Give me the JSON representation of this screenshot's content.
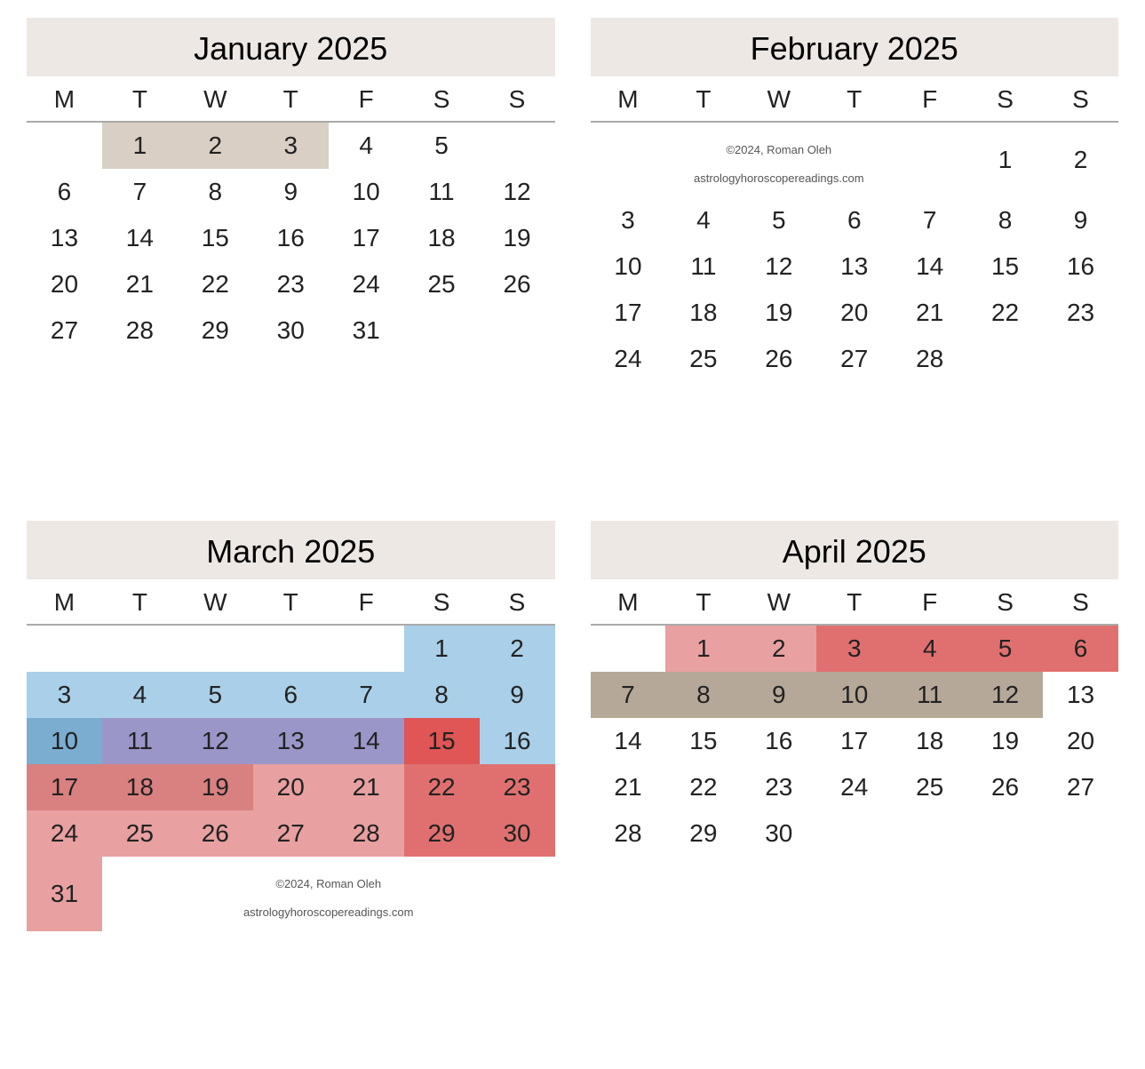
{
  "calendars": [
    {
      "id": "jan-2025",
      "title": "January 2025",
      "days_header": [
        "M",
        "T",
        "W",
        "T",
        "F",
        "S",
        "S"
      ],
      "weeks": [
        [
          {
            "day": "",
            "cls": ""
          },
          {
            "day": "1",
            "cls": "cell-beige"
          },
          {
            "day": "2",
            "cls": "cell-beige"
          },
          {
            "day": "3",
            "cls": "cell-beige"
          },
          {
            "day": "4",
            "cls": ""
          },
          {
            "day": "5",
            "cls": ""
          }
        ],
        [
          {
            "day": "6",
            "cls": ""
          },
          {
            "day": "7",
            "cls": ""
          },
          {
            "day": "8",
            "cls": ""
          },
          {
            "day": "9",
            "cls": ""
          },
          {
            "day": "10",
            "cls": ""
          },
          {
            "day": "11",
            "cls": ""
          },
          {
            "day": "12",
            "cls": ""
          }
        ],
        [
          {
            "day": "13",
            "cls": ""
          },
          {
            "day": "14",
            "cls": ""
          },
          {
            "day": "15",
            "cls": ""
          },
          {
            "day": "16",
            "cls": ""
          },
          {
            "day": "17",
            "cls": ""
          },
          {
            "day": "18",
            "cls": ""
          },
          {
            "day": "19",
            "cls": ""
          }
        ],
        [
          {
            "day": "20",
            "cls": ""
          },
          {
            "day": "21",
            "cls": ""
          },
          {
            "day": "22",
            "cls": ""
          },
          {
            "day": "23",
            "cls": ""
          },
          {
            "day": "24",
            "cls": ""
          },
          {
            "day": "25",
            "cls": ""
          },
          {
            "day": "26",
            "cls": ""
          }
        ],
        [
          {
            "day": "27",
            "cls": ""
          },
          {
            "day": "28",
            "cls": ""
          },
          {
            "day": "29",
            "cls": ""
          },
          {
            "day": "30",
            "cls": ""
          },
          {
            "day": "31",
            "cls": ""
          },
          {
            "day": "",
            "cls": ""
          },
          {
            "day": "",
            "cls": ""
          }
        ]
      ]
    },
    {
      "id": "feb-2025",
      "title": "February 2025",
      "days_header": [
        "M",
        "T",
        "W",
        "T",
        "F",
        "S",
        "S"
      ],
      "weeks": [
        [
          {
            "day": "",
            "cls": "",
            "colspan": 5,
            "copyright": true
          },
          {
            "day": "1",
            "cls": ""
          },
          {
            "day": "2",
            "cls": ""
          }
        ],
        [
          {
            "day": "3",
            "cls": ""
          },
          {
            "day": "4",
            "cls": ""
          },
          {
            "day": "5",
            "cls": ""
          },
          {
            "day": "6",
            "cls": ""
          },
          {
            "day": "7",
            "cls": ""
          },
          {
            "day": "8",
            "cls": ""
          },
          {
            "day": "9",
            "cls": ""
          }
        ],
        [
          {
            "day": "10",
            "cls": ""
          },
          {
            "day": "11",
            "cls": ""
          },
          {
            "day": "12",
            "cls": ""
          },
          {
            "day": "13",
            "cls": ""
          },
          {
            "day": "14",
            "cls": ""
          },
          {
            "day": "15",
            "cls": ""
          },
          {
            "day": "16",
            "cls": ""
          }
        ],
        [
          {
            "day": "17",
            "cls": ""
          },
          {
            "day": "18",
            "cls": ""
          },
          {
            "day": "19",
            "cls": ""
          },
          {
            "day": "20",
            "cls": ""
          },
          {
            "day": "21",
            "cls": ""
          },
          {
            "day": "22",
            "cls": ""
          },
          {
            "day": "23",
            "cls": ""
          }
        ],
        [
          {
            "day": "24",
            "cls": ""
          },
          {
            "day": "25",
            "cls": ""
          },
          {
            "day": "26",
            "cls": ""
          },
          {
            "day": "27",
            "cls": ""
          },
          {
            "day": "28",
            "cls": ""
          },
          {
            "day": "",
            "cls": ""
          },
          {
            "day": "",
            "cls": ""
          }
        ]
      ]
    },
    {
      "id": "mar-2025",
      "title": "March 2025",
      "days_header": [
        "M",
        "T",
        "W",
        "T",
        "F",
        "S",
        "S"
      ],
      "weeks": [
        [
          {
            "day": "",
            "cls": ""
          },
          {
            "day": "",
            "cls": ""
          },
          {
            "day": "",
            "cls": ""
          },
          {
            "day": "",
            "cls": ""
          },
          {
            "day": "",
            "cls": ""
          },
          {
            "day": "1",
            "cls": "cell-blue"
          },
          {
            "day": "2",
            "cls": "cell-blue"
          }
        ],
        [
          {
            "day": "3",
            "cls": "cell-blue"
          },
          {
            "day": "4",
            "cls": "cell-blue"
          },
          {
            "day": "5",
            "cls": "cell-blue"
          },
          {
            "day": "6",
            "cls": "cell-blue"
          },
          {
            "day": "7",
            "cls": "cell-blue"
          },
          {
            "day": "8",
            "cls": "cell-blue"
          },
          {
            "day": "9",
            "cls": "cell-blue"
          }
        ],
        [
          {
            "day": "10",
            "cls": "cell-blue-med"
          },
          {
            "day": "11",
            "cls": "cell-purple"
          },
          {
            "day": "12",
            "cls": "cell-purple"
          },
          {
            "day": "13",
            "cls": "cell-purple"
          },
          {
            "day": "14",
            "cls": "cell-purple"
          },
          {
            "day": "15",
            "cls": "cell-red"
          },
          {
            "day": "16",
            "cls": "cell-blue"
          }
        ],
        [
          {
            "day": "17",
            "cls": "cell-pink"
          },
          {
            "day": "18",
            "cls": "cell-pink"
          },
          {
            "day": "19",
            "cls": "cell-pink"
          },
          {
            "day": "20",
            "cls": "cell-pink-light"
          },
          {
            "day": "21",
            "cls": "cell-pink-light"
          },
          {
            "day": "22",
            "cls": "cell-salmon"
          },
          {
            "day": "23",
            "cls": "cell-salmon"
          }
        ],
        [
          {
            "day": "24",
            "cls": "cell-pink-light"
          },
          {
            "day": "25",
            "cls": "cell-pink-light"
          },
          {
            "day": "26",
            "cls": "cell-pink-light"
          },
          {
            "day": "27",
            "cls": "cell-pink-light"
          },
          {
            "day": "28",
            "cls": "cell-pink-light"
          },
          {
            "day": "29",
            "cls": "cell-salmon"
          },
          {
            "day": "30",
            "cls": "cell-salmon"
          }
        ],
        [
          {
            "day": "31",
            "cls": "cell-pink-light"
          },
          {
            "day": "",
            "cls": "",
            "copyright": true,
            "colspan": 6
          }
        ]
      ]
    },
    {
      "id": "apr-2025",
      "title": "April 2025",
      "days_header": [
        "M",
        "T",
        "W",
        "T",
        "F",
        "S",
        "S"
      ],
      "weeks": [
        [
          {
            "day": "",
            "cls": ""
          },
          {
            "day": "1",
            "cls": "cell-pink-light"
          },
          {
            "day": "2",
            "cls": "cell-pink-light"
          },
          {
            "day": "3",
            "cls": "cell-salmon"
          },
          {
            "day": "4",
            "cls": "cell-salmon"
          },
          {
            "day": "5",
            "cls": "cell-salmon"
          },
          {
            "day": "6",
            "cls": "cell-salmon"
          }
        ],
        [
          {
            "day": "7",
            "cls": "cell-tan"
          },
          {
            "day": "8",
            "cls": "cell-tan"
          },
          {
            "day": "9",
            "cls": "cell-tan"
          },
          {
            "day": "10",
            "cls": "cell-tan"
          },
          {
            "day": "11",
            "cls": "cell-tan"
          },
          {
            "day": "12",
            "cls": "cell-tan"
          },
          {
            "day": "13",
            "cls": ""
          }
        ],
        [
          {
            "day": "14",
            "cls": ""
          },
          {
            "day": "15",
            "cls": ""
          },
          {
            "day": "16",
            "cls": ""
          },
          {
            "day": "17",
            "cls": ""
          },
          {
            "day": "18",
            "cls": ""
          },
          {
            "day": "19",
            "cls": ""
          },
          {
            "day": "20",
            "cls": ""
          }
        ],
        [
          {
            "day": "21",
            "cls": ""
          },
          {
            "day": "22",
            "cls": ""
          },
          {
            "day": "23",
            "cls": ""
          },
          {
            "day": "24",
            "cls": ""
          },
          {
            "day": "25",
            "cls": ""
          },
          {
            "day": "26",
            "cls": ""
          },
          {
            "day": "27",
            "cls": ""
          }
        ],
        [
          {
            "day": "28",
            "cls": ""
          },
          {
            "day": "29",
            "cls": ""
          },
          {
            "day": "30",
            "cls": ""
          },
          {
            "day": "",
            "cls": ""
          },
          {
            "day": "",
            "cls": ""
          },
          {
            "day": "",
            "cls": ""
          },
          {
            "day": "",
            "cls": ""
          }
        ]
      ]
    }
  ],
  "copyright": {
    "line1": "©2024, Roman Oleh",
    "line2": "astrologyhoroscopereadings.com"
  }
}
